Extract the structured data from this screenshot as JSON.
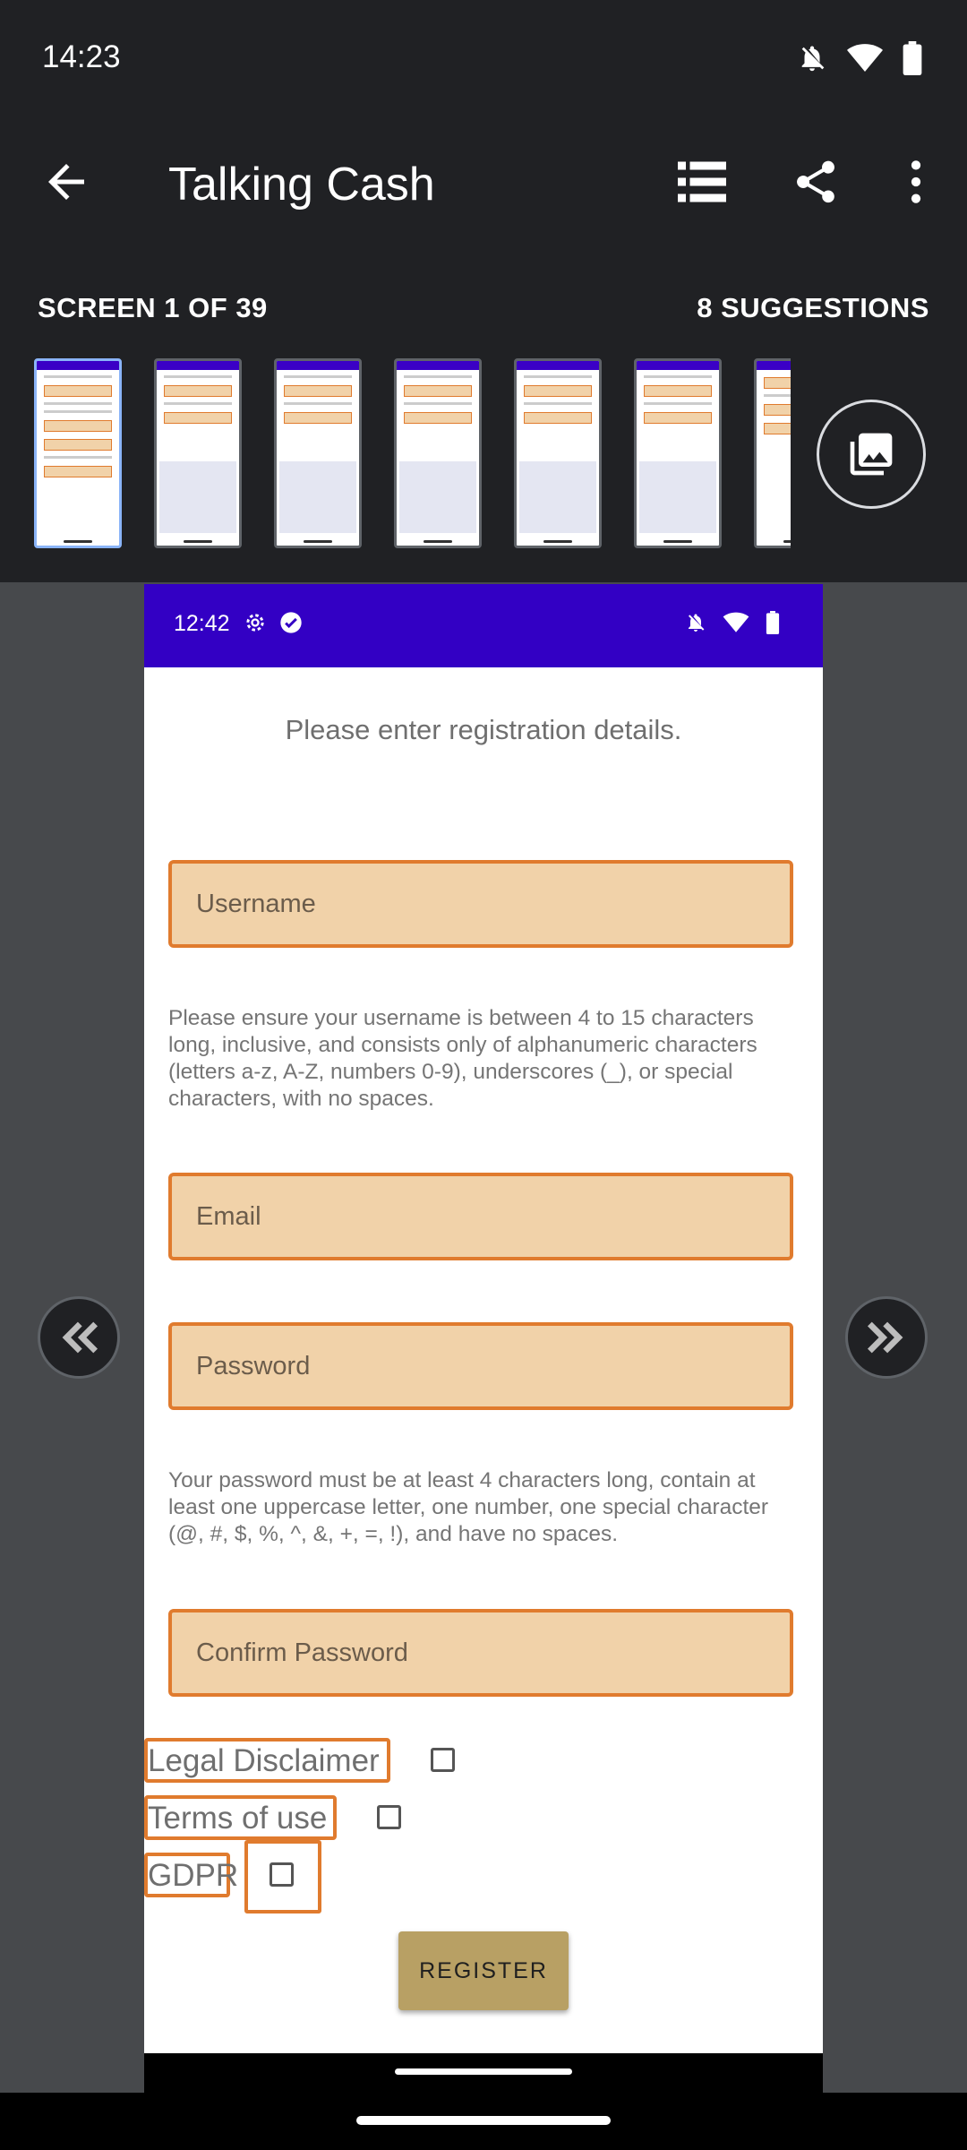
{
  "status": {
    "time": "14:23"
  },
  "app": {
    "title": "Talking Cash",
    "screen_counter": "SCREEN 1 OF 39",
    "suggestions": "8 SUGGESTIONS"
  },
  "device": {
    "status_time": "12:42",
    "heading": "Please enter registration details.",
    "username_placeholder": "Username",
    "username_help": "Please ensure your username is between 4 to 15 characters long, inclusive, and consists only of alphanumeric characters (letters a-z, A-Z, numbers 0-9), underscores (_), or special characters, with no spaces.",
    "email_placeholder": "Email",
    "password_placeholder": "Password",
    "password_help": "Your password must be at least 4 characters long, contain at least one uppercase letter, one number, one special character (@, #, $, %, ^, &, +, =, !), and have no spaces.",
    "confirm_placeholder": "Confirm Password",
    "legal_label": "Legal Disclaimer",
    "terms_label": "Terms of use",
    "gdpr_label": "GDPR",
    "register_label": "REGISTER"
  },
  "colors": {
    "accent_orange": "#e07b2e",
    "field_fill": "#f1d2a9",
    "device_status": "#3300c4",
    "register_button": "#b8a064"
  }
}
